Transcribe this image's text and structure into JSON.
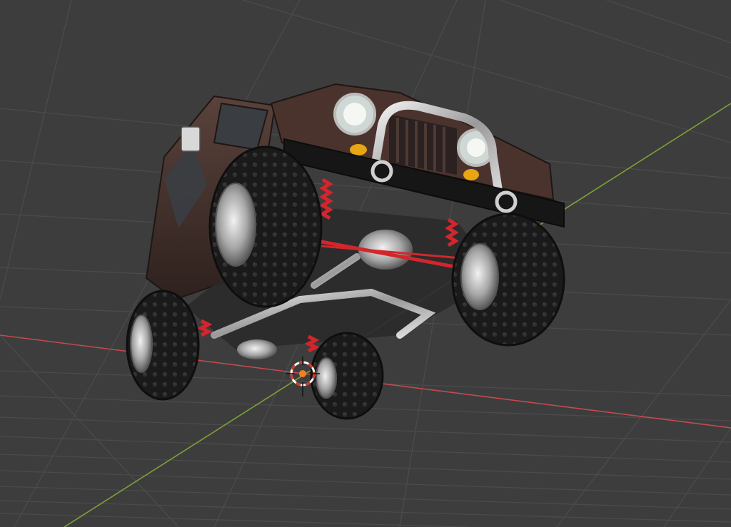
{
  "viewport": {
    "background": "#3d3d3d",
    "grid_color": "#4c4c4c",
    "x_axis_color": "#c44a4e",
    "y_axis_color": "#7da13a"
  },
  "model": {
    "body_color": "#4a3530",
    "body_shadow": "#2f2320",
    "tire_color": "#1b1b1b",
    "chrome_color": "#c9c9c9",
    "spring_color": "#d3262c",
    "indicator_color": "#e8a514"
  },
  "cursor": {
    "name": "3d-cursor",
    "ring_color": "#d33c2c",
    "center_color": "#f08020"
  }
}
